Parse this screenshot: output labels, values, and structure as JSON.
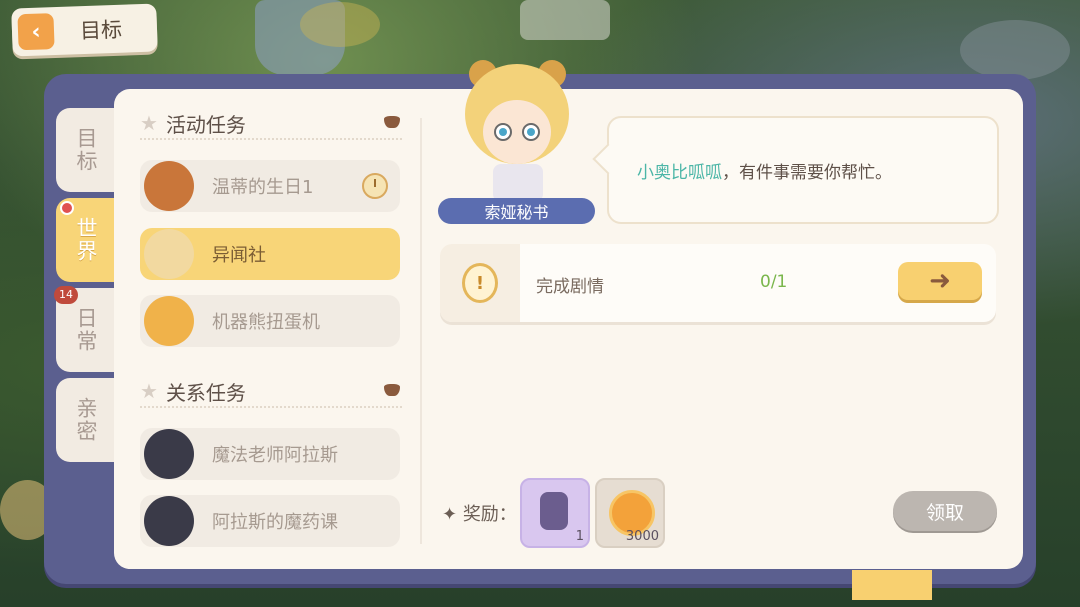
{
  "header": {
    "back_label": "目标"
  },
  "side_tabs": [
    {
      "label": "目标",
      "active": false
    },
    {
      "label": "世界",
      "active": true,
      "dot": true
    },
    {
      "label": "日常",
      "active": false,
      "badge": "14"
    },
    {
      "label": "亲密",
      "active": false
    }
  ],
  "sections": {
    "activity": {
      "title": "活动任务",
      "items": [
        {
          "label": "温蒂的生日1",
          "has_clock": true
        },
        {
          "label": "异闻社",
          "active": true
        },
        {
          "label": "机器熊扭蛋机"
        }
      ]
    },
    "relation": {
      "title": "关系任务",
      "items": [
        {
          "label": "魔法老师阿拉斯"
        },
        {
          "label": "阿拉斯的魔药课"
        }
      ]
    }
  },
  "npc": {
    "name": "索娅秘书",
    "dialogue_highlight": "小奥比呱呱",
    "dialogue_rest": "，有件事需要你帮忙。"
  },
  "objective": {
    "label": "完成剧情",
    "progress": "0/1",
    "go_icon": "arrow-right-icon"
  },
  "rewards": {
    "label": "奖励：",
    "items": [
      {
        "icon": "doll-reward-icon",
        "count": "1"
      },
      {
        "icon": "coin-reward-icon",
        "count": "3000"
      }
    ],
    "claim_label": "领取"
  },
  "colors": {
    "frame": "#5b5f8f",
    "panel": "#fbf6ee",
    "active_yellow": "#f8d578",
    "name_tag": "#5b6db0",
    "highlight_teal": "#4cb6a7",
    "progress_green": "#7ab64c"
  }
}
